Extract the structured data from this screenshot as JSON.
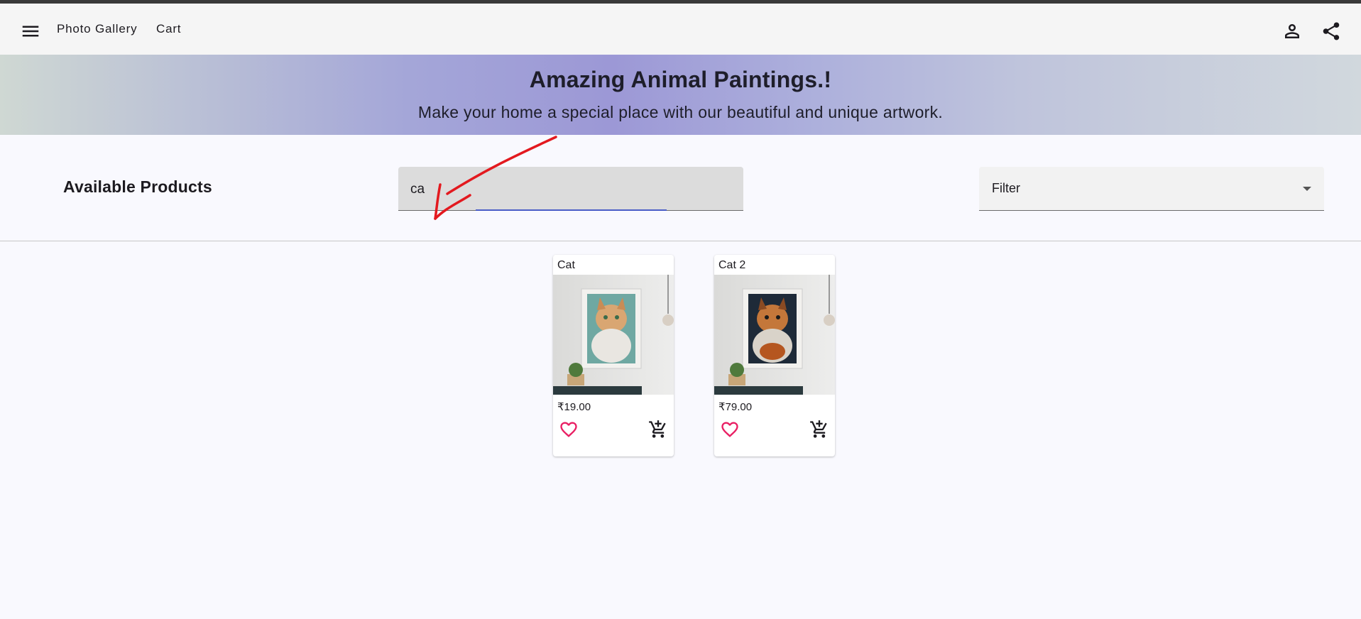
{
  "toolbar": {
    "menu_icon": "menu-icon",
    "links": [
      "Photo Gallery",
      "Cart"
    ],
    "account_icon": "person-icon",
    "share_icon": "share-icon"
  },
  "banner": {
    "title": "Amazing Animal Paintings.!",
    "subtitle": "Make your home a special place with our beautiful and unique artwork."
  },
  "main": {
    "section_title": "Available Products",
    "search": {
      "value": "ca",
      "placeholder": ""
    },
    "filter": {
      "label": "Filter"
    }
  },
  "products": [
    {
      "name": "Cat",
      "price": "₹19.00",
      "image": "cat-painting-light",
      "fav_icon": "heart-outline-icon",
      "cart_icon": "add-shopping-cart-icon"
    },
    {
      "name": "Cat 2",
      "price": "₹79.00",
      "image": "cat-painting-dark",
      "fav_icon": "heart-outline-icon",
      "cart_icon": "add-shopping-cart-icon"
    }
  ],
  "colors": {
    "accent": "#4a5dc7",
    "favorite": "#e91e63",
    "annotation": "#e3191f"
  }
}
